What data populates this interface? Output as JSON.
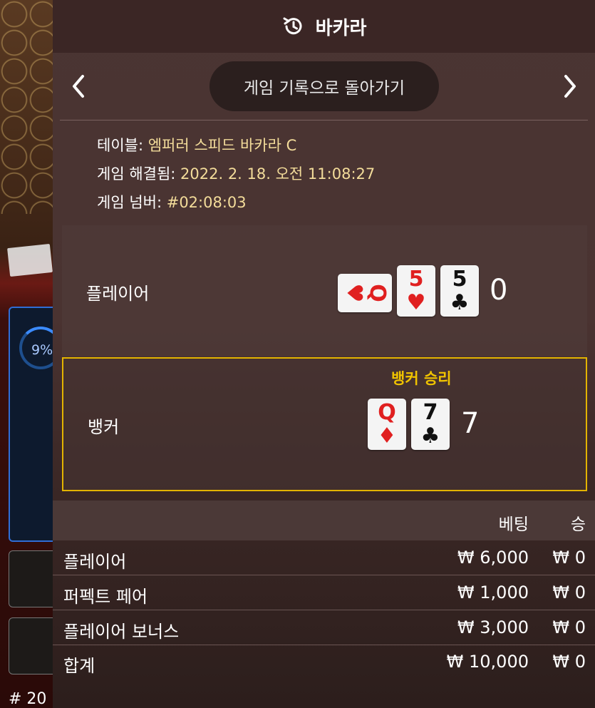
{
  "header": {
    "title": "바카라",
    "back_label": "게임 기록으로 돌아가기"
  },
  "info": {
    "table_label": "테이블: ",
    "table_value": "엠퍼러 스피드 바카라 C",
    "settled_label": "게임 해결됨: ",
    "settled_value": "2022. 2. 18. 오전 11:08:27",
    "number_label": "게임 넘버: ",
    "number_value": "#02:08:03"
  },
  "player": {
    "label": "플레이어",
    "score": "0",
    "cards": [
      {
        "rank": "Q",
        "suit": "♥",
        "color": "red",
        "orientation": "sideways"
      },
      {
        "rank": "5",
        "suit": "♥",
        "color": "red"
      },
      {
        "rank": "5",
        "suit": "♣",
        "color": "black"
      }
    ]
  },
  "banker": {
    "label": "뱅커",
    "result": "뱅커 승리",
    "score": "7",
    "cards": [
      {
        "rank": "Q",
        "suit": "♦",
        "color": "red"
      },
      {
        "rank": "7",
        "suit": "♣",
        "color": "black"
      }
    ]
  },
  "bets": {
    "col_bet": "베팅",
    "col_win": "승",
    "rows": [
      {
        "name": "플레이어",
        "bet": "₩ 6,000",
        "win": "₩ 0"
      },
      {
        "name": "퍼펙트 페어",
        "bet": "₩ 1,000",
        "win": "₩ 0"
      },
      {
        "name": "플레이어 보너스",
        "bet": "₩ 3,000",
        "win": "₩ 0"
      }
    ],
    "total": {
      "name": "합계",
      "bet": "₩ 10,000",
      "win": "₩ 0"
    }
  },
  "background": {
    "timer_text": "9%",
    "round_number": "# 20"
  },
  "colors": {
    "accent_gold": "#e3b400",
    "info_value": "#f3dc9a",
    "card_red": "#e02020"
  },
  "icons": {
    "history": "history-icon",
    "prev": "chevron-left-icon",
    "next": "chevron-right-icon"
  }
}
